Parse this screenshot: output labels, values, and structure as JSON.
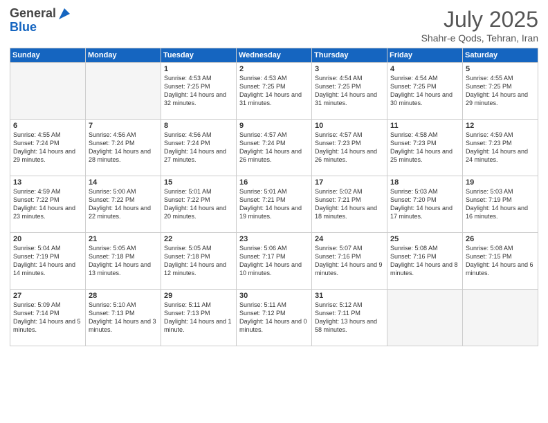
{
  "logo": {
    "general": "General",
    "blue": "Blue"
  },
  "header": {
    "month_year": "July 2025",
    "location": "Shahr-e Qods, Tehran, Iran"
  },
  "weekdays": [
    "Sunday",
    "Monday",
    "Tuesday",
    "Wednesday",
    "Thursday",
    "Friday",
    "Saturday"
  ],
  "weeks": [
    [
      {
        "day": "",
        "empty": true
      },
      {
        "day": "",
        "empty": true
      },
      {
        "day": "1",
        "sunrise": "Sunrise: 4:53 AM",
        "sunset": "Sunset: 7:25 PM",
        "daylight": "Daylight: 14 hours and 32 minutes."
      },
      {
        "day": "2",
        "sunrise": "Sunrise: 4:53 AM",
        "sunset": "Sunset: 7:25 PM",
        "daylight": "Daylight: 14 hours and 31 minutes."
      },
      {
        "day": "3",
        "sunrise": "Sunrise: 4:54 AM",
        "sunset": "Sunset: 7:25 PM",
        "daylight": "Daylight: 14 hours and 31 minutes."
      },
      {
        "day": "4",
        "sunrise": "Sunrise: 4:54 AM",
        "sunset": "Sunset: 7:25 PM",
        "daylight": "Daylight: 14 hours and 30 minutes."
      },
      {
        "day": "5",
        "sunrise": "Sunrise: 4:55 AM",
        "sunset": "Sunset: 7:25 PM",
        "daylight": "Daylight: 14 hours and 29 minutes."
      }
    ],
    [
      {
        "day": "6",
        "sunrise": "Sunrise: 4:55 AM",
        "sunset": "Sunset: 7:24 PM",
        "daylight": "Daylight: 14 hours and 29 minutes."
      },
      {
        "day": "7",
        "sunrise": "Sunrise: 4:56 AM",
        "sunset": "Sunset: 7:24 PM",
        "daylight": "Daylight: 14 hours and 28 minutes."
      },
      {
        "day": "8",
        "sunrise": "Sunrise: 4:56 AM",
        "sunset": "Sunset: 7:24 PM",
        "daylight": "Daylight: 14 hours and 27 minutes."
      },
      {
        "day": "9",
        "sunrise": "Sunrise: 4:57 AM",
        "sunset": "Sunset: 7:24 PM",
        "daylight": "Daylight: 14 hours and 26 minutes."
      },
      {
        "day": "10",
        "sunrise": "Sunrise: 4:57 AM",
        "sunset": "Sunset: 7:23 PM",
        "daylight": "Daylight: 14 hours and 26 minutes."
      },
      {
        "day": "11",
        "sunrise": "Sunrise: 4:58 AM",
        "sunset": "Sunset: 7:23 PM",
        "daylight": "Daylight: 14 hours and 25 minutes."
      },
      {
        "day": "12",
        "sunrise": "Sunrise: 4:59 AM",
        "sunset": "Sunset: 7:23 PM",
        "daylight": "Daylight: 14 hours and 24 minutes."
      }
    ],
    [
      {
        "day": "13",
        "sunrise": "Sunrise: 4:59 AM",
        "sunset": "Sunset: 7:22 PM",
        "daylight": "Daylight: 14 hours and 23 minutes."
      },
      {
        "day": "14",
        "sunrise": "Sunrise: 5:00 AM",
        "sunset": "Sunset: 7:22 PM",
        "daylight": "Daylight: 14 hours and 22 minutes."
      },
      {
        "day": "15",
        "sunrise": "Sunrise: 5:01 AM",
        "sunset": "Sunset: 7:22 PM",
        "daylight": "Daylight: 14 hours and 20 minutes."
      },
      {
        "day": "16",
        "sunrise": "Sunrise: 5:01 AM",
        "sunset": "Sunset: 7:21 PM",
        "daylight": "Daylight: 14 hours and 19 minutes."
      },
      {
        "day": "17",
        "sunrise": "Sunrise: 5:02 AM",
        "sunset": "Sunset: 7:21 PM",
        "daylight": "Daylight: 14 hours and 18 minutes."
      },
      {
        "day": "18",
        "sunrise": "Sunrise: 5:03 AM",
        "sunset": "Sunset: 7:20 PM",
        "daylight": "Daylight: 14 hours and 17 minutes."
      },
      {
        "day": "19",
        "sunrise": "Sunrise: 5:03 AM",
        "sunset": "Sunset: 7:19 PM",
        "daylight": "Daylight: 14 hours and 16 minutes."
      }
    ],
    [
      {
        "day": "20",
        "sunrise": "Sunrise: 5:04 AM",
        "sunset": "Sunset: 7:19 PM",
        "daylight": "Daylight: 14 hours and 14 minutes."
      },
      {
        "day": "21",
        "sunrise": "Sunrise: 5:05 AM",
        "sunset": "Sunset: 7:18 PM",
        "daylight": "Daylight: 14 hours and 13 minutes."
      },
      {
        "day": "22",
        "sunrise": "Sunrise: 5:05 AM",
        "sunset": "Sunset: 7:18 PM",
        "daylight": "Daylight: 14 hours and 12 minutes."
      },
      {
        "day": "23",
        "sunrise": "Sunrise: 5:06 AM",
        "sunset": "Sunset: 7:17 PM",
        "daylight": "Daylight: 14 hours and 10 minutes."
      },
      {
        "day": "24",
        "sunrise": "Sunrise: 5:07 AM",
        "sunset": "Sunset: 7:16 PM",
        "daylight": "Daylight: 14 hours and 9 minutes."
      },
      {
        "day": "25",
        "sunrise": "Sunrise: 5:08 AM",
        "sunset": "Sunset: 7:16 PM",
        "daylight": "Daylight: 14 hours and 8 minutes."
      },
      {
        "day": "26",
        "sunrise": "Sunrise: 5:08 AM",
        "sunset": "Sunset: 7:15 PM",
        "daylight": "Daylight: 14 hours and 6 minutes."
      }
    ],
    [
      {
        "day": "27",
        "sunrise": "Sunrise: 5:09 AM",
        "sunset": "Sunset: 7:14 PM",
        "daylight": "Daylight: 14 hours and 5 minutes."
      },
      {
        "day": "28",
        "sunrise": "Sunrise: 5:10 AM",
        "sunset": "Sunset: 7:13 PM",
        "daylight": "Daylight: 14 hours and 3 minutes."
      },
      {
        "day": "29",
        "sunrise": "Sunrise: 5:11 AM",
        "sunset": "Sunset: 7:13 PM",
        "daylight": "Daylight: 14 hours and 1 minute."
      },
      {
        "day": "30",
        "sunrise": "Sunrise: 5:11 AM",
        "sunset": "Sunset: 7:12 PM",
        "daylight": "Daylight: 14 hours and 0 minutes."
      },
      {
        "day": "31",
        "sunrise": "Sunrise: 5:12 AM",
        "sunset": "Sunset: 7:11 PM",
        "daylight": "Daylight: 13 hours and 58 minutes."
      },
      {
        "day": "",
        "empty": true
      },
      {
        "day": "",
        "empty": true
      }
    ]
  ]
}
